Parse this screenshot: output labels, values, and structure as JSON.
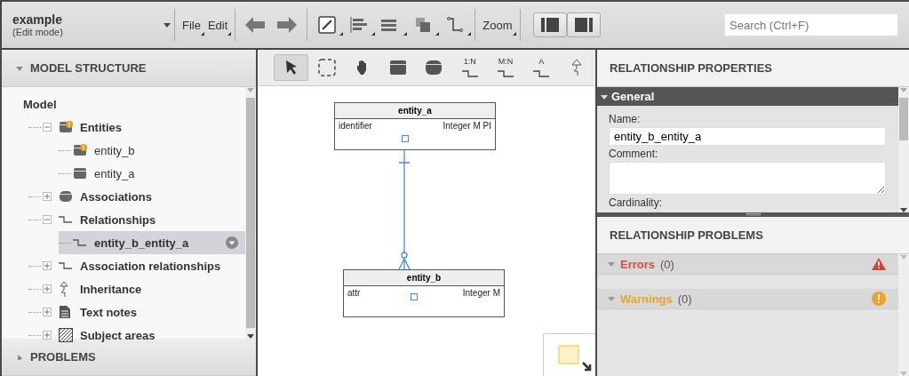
{
  "header": {
    "title": "example",
    "subtitle": "(Edit mode)",
    "menus": [
      {
        "label": "File"
      },
      {
        "label": "Edit"
      }
    ],
    "zoom_menu": {
      "label": "Zoom"
    },
    "search": {
      "placeholder": "Search (Ctrl+F)"
    }
  },
  "model_structure": {
    "title": "MODEL STRUCTURE",
    "expanded": true,
    "root": "Model",
    "items": [
      {
        "label": "Entities",
        "kind": "entity-group",
        "expanded": true,
        "warning": true,
        "selected": false,
        "children": [
          {
            "label": "entity_b",
            "kind": "entity",
            "warning": true,
            "selected": false
          },
          {
            "label": "entity_a",
            "kind": "entity",
            "warning": false,
            "selected": false
          }
        ]
      },
      {
        "label": "Associations",
        "kind": "association",
        "expanded": false,
        "selected": false
      },
      {
        "label": "Relationships",
        "kind": "relationship",
        "expanded": true,
        "selected": false,
        "children": [
          {
            "label": "entity_b_entity_a",
            "kind": "relationship",
            "selected": true
          }
        ]
      },
      {
        "label": "Association relationships",
        "kind": "relationship",
        "expanded": false,
        "selected": false
      },
      {
        "label": "Inheritance",
        "kind": "inheritance",
        "expanded": false,
        "selected": false
      },
      {
        "label": "Text notes",
        "kind": "note",
        "expanded": false,
        "selected": false
      },
      {
        "label": "Subject areas",
        "kind": "area",
        "expanded": false,
        "selected": false
      }
    ]
  },
  "problems_panel": {
    "title": "PROBLEMS",
    "expanded": false
  },
  "canvas": {
    "tools": [
      {
        "kind": "pointer",
        "selected": true
      },
      {
        "kind": "marquee",
        "selected": false
      },
      {
        "kind": "hand",
        "selected": false
      },
      {
        "kind": "entity",
        "selected": false
      },
      {
        "kind": "association",
        "selected": false
      },
      {
        "kind": "link",
        "label": "1:N",
        "selected": false
      },
      {
        "kind": "link",
        "label": "M:N",
        "selected": false
      },
      {
        "kind": "link",
        "label": "A",
        "selected": false
      },
      {
        "kind": "inheritance",
        "selected": false
      }
    ],
    "entities": [
      {
        "name": "entity_a",
        "attributes": [
          {
            "name": "identifier",
            "type": "Integer M PI"
          }
        ]
      },
      {
        "name": "entity_b",
        "attributes": [
          {
            "name": "attr",
            "type": "Integer M"
          }
        ]
      }
    ]
  },
  "properties": {
    "title": "RELATIONSHIP PROPERTIES",
    "section": {
      "title": "General",
      "expanded": true
    },
    "fields": [
      {
        "label": "Name:",
        "kind": "input",
        "value": "entity_b_entity_a"
      },
      {
        "label": "Comment:",
        "kind": "textarea"
      },
      {
        "label": "Cardinality:",
        "kind": "cut"
      }
    ]
  },
  "relationship_problems": {
    "title": "RELATIONSHIP PROBLEMS",
    "groups": [
      {
        "kind": "error",
        "label": "Errors",
        "count": "(0)",
        "expanded": true
      },
      {
        "kind": "warning",
        "label": "Warnings",
        "count": "(0)",
        "expanded": true
      }
    ]
  }
}
